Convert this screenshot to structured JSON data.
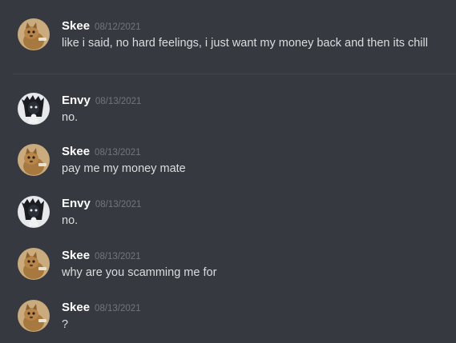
{
  "messages": [
    {
      "author": "Skee",
      "avatar": "cat-avatar-icon",
      "timestamp": "08/12/2021",
      "text": "like i said, no hard feelings, i just want my money back and then its chill"
    },
    {
      "author": "Envy",
      "avatar": "skull-avatar-icon",
      "timestamp": "08/13/2021",
      "text": "no."
    },
    {
      "author": "Skee",
      "avatar": "cat-avatar-icon",
      "timestamp": "08/13/2021",
      "text": "pay me my money mate"
    },
    {
      "author": "Envy",
      "avatar": "skull-avatar-icon",
      "timestamp": "08/13/2021",
      "text": "no."
    },
    {
      "author": "Skee",
      "avatar": "cat-avatar-icon",
      "timestamp": "08/13/2021",
      "text": "why are you scamming me for"
    },
    {
      "author": "Skee",
      "avatar": "cat-avatar-icon",
      "timestamp": "08/13/2021",
      "text": "?"
    }
  ],
  "colors": {
    "background": "#36393f",
    "username": "#ffffff",
    "timestamp": "#72767d",
    "message_text": "#dcddde"
  }
}
